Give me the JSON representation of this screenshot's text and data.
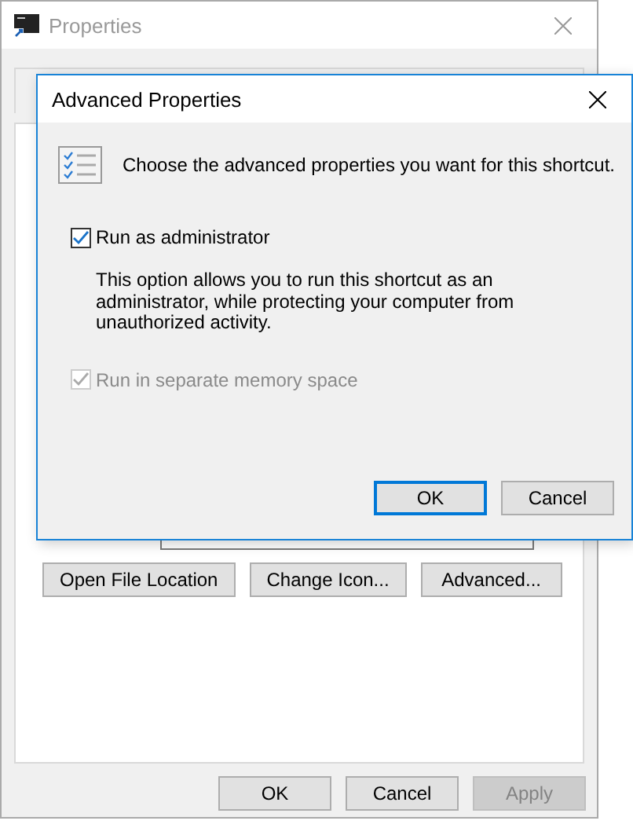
{
  "main_window": {
    "title": "Properties",
    "active": false,
    "buttons": [
      {
        "label": "Open File Location",
        "disabled": false
      },
      {
        "label": "Change Icon...",
        "disabled": false
      },
      {
        "label": "Advanced...",
        "disabled": false
      }
    ],
    "footer_buttons": [
      {
        "label": "OK",
        "disabled": false
      },
      {
        "label": "Cancel",
        "disabled": false
      },
      {
        "label": "Apply",
        "disabled": true
      }
    ]
  },
  "dialog": {
    "title": "Advanced Properties",
    "active": true,
    "intro": "Choose the advanced properties you want for this shortcut.",
    "options": [
      {
        "label": "Run as administrator",
        "checked": true,
        "disabled": false,
        "description": "This option allows you to run this shortcut as an administrator, while protecting your computer from unauthorized activity."
      },
      {
        "label": "Run in separate memory space",
        "checked": true,
        "disabled": true
      }
    ],
    "buttons": [
      {
        "label": "OK",
        "default": true
      },
      {
        "label": "Cancel",
        "default": false
      }
    ]
  }
}
